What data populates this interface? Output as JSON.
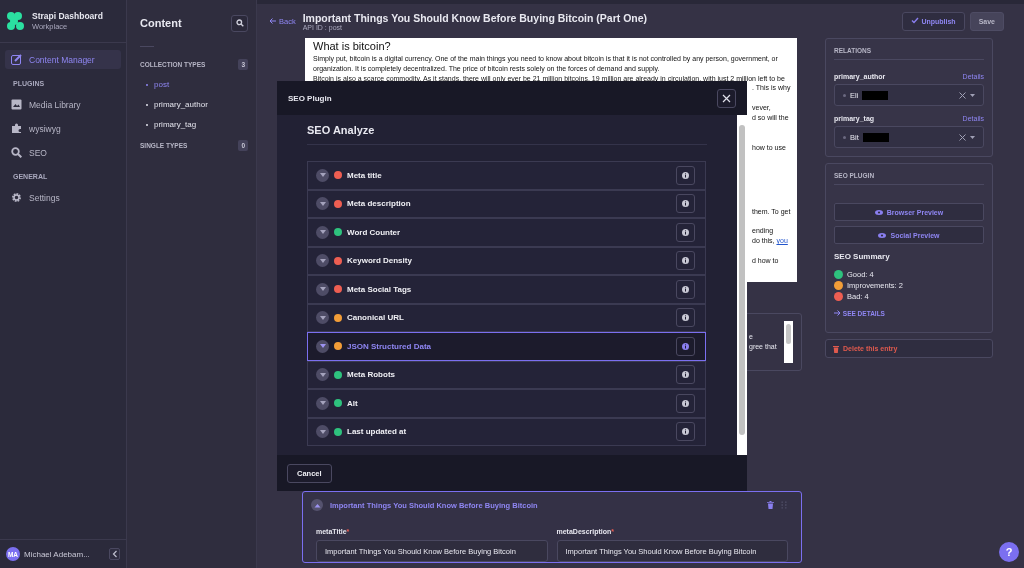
{
  "brand": {
    "title": "Strapi Dashboard",
    "subtitle": "Workplace"
  },
  "nav": {
    "items": [
      {
        "label": "Content Manager",
        "selected": true
      }
    ],
    "sections": [
      {
        "heading": "PLUGINS",
        "items": [
          {
            "label": "Media Library",
            "selected": false
          },
          {
            "label": "wysiwyg",
            "selected": false
          },
          {
            "label": "SEO",
            "selected": false
          }
        ]
      },
      {
        "heading": "GENERAL",
        "items": [
          {
            "label": "Settings",
            "selected": false
          }
        ]
      }
    ]
  },
  "user": {
    "initials": "MA",
    "name": "Michael Adebam..."
  },
  "content_panel": {
    "title": "Content",
    "groups": [
      {
        "heading": "COLLECTION TYPES",
        "count": "3",
        "items": [
          {
            "label": "post",
            "selected": true
          },
          {
            "label": "primary_author",
            "selected": false
          },
          {
            "label": "primary_tag",
            "selected": false
          }
        ]
      },
      {
        "heading": "SINGLE TYPES",
        "count": "0"
      }
    ]
  },
  "header": {
    "back": "Back",
    "title": "Important Things You Should Know Before Buying Bitcoin (Part One)",
    "api_id": "API ID : post",
    "buttons": [
      {
        "label": "Unpublish",
        "kind": "outline"
      },
      {
        "label": "Save",
        "kind": "plain"
      }
    ]
  },
  "document": {
    "heading": "What is bitcoin?",
    "paragraphs": [
      "Simply put, bitcoin is a digital currency. One of the main things you need to know about bitcoin is that it is not controlled by any person, government, or organization. It is completely decentralized. The price of bitcoin rests solely on the forces of demand and supply.",
      "Bitcoin is also a scarce commodity. As it stands, there will only ever be 21 million bitcoins, 19 million are already in circulation, with just 2 million left to be"
    ],
    "fragments": [
      {
        "text": ". This is why"
      },
      {
        "text": "vever,"
      },
      {
        "text": "d so will the"
      },
      {
        "text": "how to use"
      },
      {
        "text": "them. To get"
      },
      {
        "text": "ending"
      },
      {
        "text": "do this,",
        "link": "you"
      },
      {
        "text": "d how to"
      }
    ]
  },
  "second_editor": {
    "fragments": [
      "e",
      "gree that"
    ]
  },
  "component": {
    "title": "Important Things You Should Know Before Buying Bitcoin",
    "fields": [
      {
        "label": "metaTitle",
        "required_mark": "*",
        "value": "Important Things You Should Know Before Buying Bitcoin"
      },
      {
        "label": "metaDescription",
        "required_mark": "*",
        "value": "Important Things You Should Know Before Buying Bitcoin"
      }
    ]
  },
  "relations": {
    "heading": "RELATIONS",
    "fields": [
      {
        "label": "primary_author",
        "link": "Details",
        "value": "Eli"
      },
      {
        "label": "primary_tag",
        "link": "Details",
        "value": "Bit"
      }
    ]
  },
  "seo_plugin": {
    "heading": "SEO PLUGIN",
    "buttons": [
      "Browser Preview",
      "Social Preview"
    ],
    "summary_title": "SEO Summary",
    "summary": [
      {
        "label": "Good: 4",
        "color": "#2ec27e"
      },
      {
        "label": "Improvements: 2",
        "color": "#f29d38"
      },
      {
        "label": "Bad: 4",
        "color": "#ee5e52"
      }
    ],
    "details_link": "SEE DETAILS"
  },
  "delete_button": "Delete this entry",
  "help_button": "?",
  "modal": {
    "title": "SEO Plugin",
    "heading": "SEO Analyze",
    "rows": [
      {
        "label": "Meta title",
        "color": "#ee5e52",
        "selected": false
      },
      {
        "label": "Meta description",
        "color": "#ee5e52",
        "selected": false
      },
      {
        "label": "Word Counter",
        "color": "#2ec27e",
        "selected": false
      },
      {
        "label": "Keyword Density",
        "color": "#ee5e52",
        "selected": false
      },
      {
        "label": "Meta Social Tags",
        "color": "#ee5e52",
        "selected": false
      },
      {
        "label": "Canonical URL",
        "color": "#f29d38",
        "selected": false
      },
      {
        "label": "JSON Structured Data",
        "color": "#f29d38",
        "selected": true
      },
      {
        "label": "Meta Robots",
        "color": "#2ec27e",
        "selected": false
      },
      {
        "label": "Alt",
        "color": "#2ec27e",
        "selected": false
      },
      {
        "label": "Last updated at",
        "color": "#2ec27e",
        "selected": false
      }
    ],
    "cancel": "Cancel"
  }
}
